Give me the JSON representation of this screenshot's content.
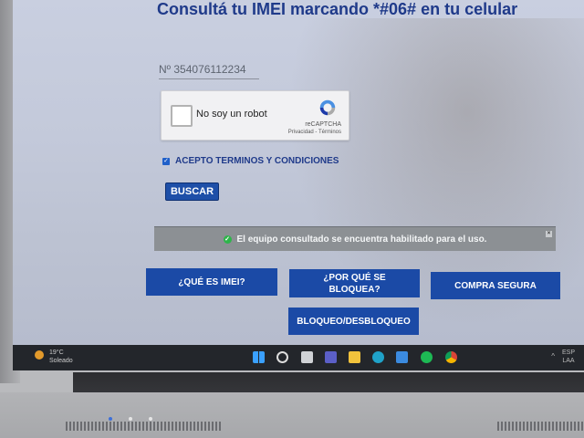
{
  "page": {
    "title": "Consultá tu IMEI marcando *#06# en tu celular"
  },
  "imei": {
    "value": "Nº 354076112234"
  },
  "captcha": {
    "label": "No soy un robot",
    "brand": "reCAPTCHA",
    "links": "Privacidad - Términos",
    "logo_icon": "recaptcha-icon"
  },
  "terms": {
    "checked": true,
    "label": "ACEPTO TERMINOS Y CONDICIONES"
  },
  "search_button": {
    "label": "BUSCAR"
  },
  "status": {
    "message": "El equipo consultado se encuentra habilitado para el uso.",
    "icon": "check-circle-icon",
    "color": "#2eb54a"
  },
  "nav_buttons": [
    {
      "label": "¿QUÉ ES IMEI?"
    },
    {
      "label": "¿POR QUÉ SE BLOQUEA?"
    },
    {
      "label": "COMPRA SEGURA"
    },
    {
      "label": "BLOQUEO/DESBLOQUEO"
    }
  ],
  "taskbar": {
    "weather_temp": "19°C",
    "weather_desc": "Soleado",
    "lang": "ESP",
    "lang_sub": "LAA",
    "icons": [
      "windows-start-icon",
      "search-icon",
      "task-view-icon",
      "chat-icon",
      "file-explorer-icon",
      "edge-icon",
      "store-icon",
      "spotify-icon",
      "chrome-icon"
    ]
  },
  "colors": {
    "title": "#1f3a8a",
    "button_bg": "#1b4aa6",
    "status_bar_bg": "#8c9094"
  }
}
